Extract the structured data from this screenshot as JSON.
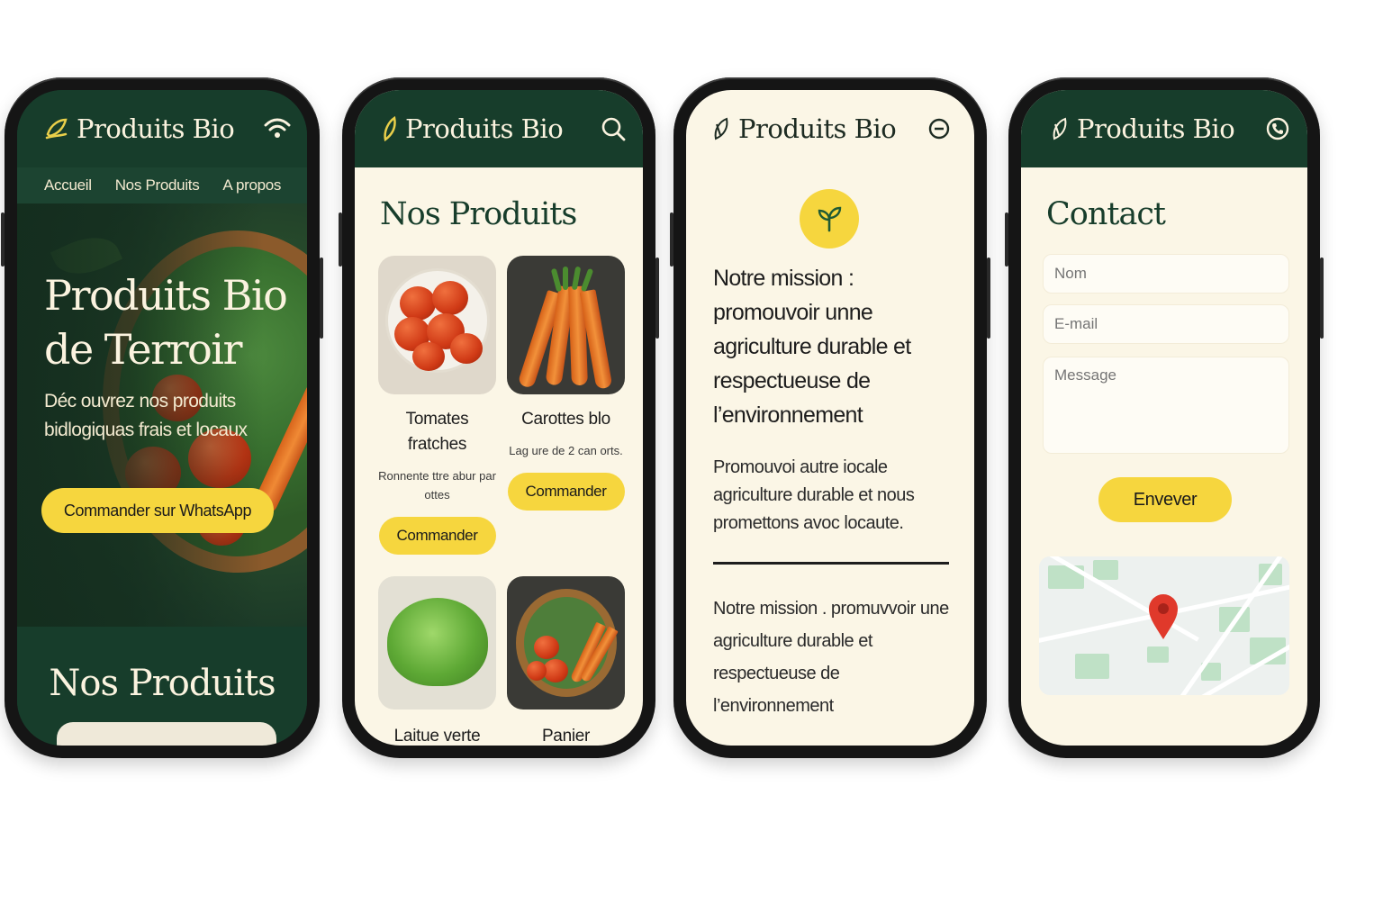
{
  "brand": "Produits Bio",
  "colors": {
    "dark_green": "#173d2b",
    "cream": "#fbf6e6",
    "accent_yellow": "#f6d63e",
    "map_pin": "#e0392b"
  },
  "home": {
    "header_icon": "wifi-icon",
    "nav": [
      "Accueil",
      "Nos Produits",
      "A propos"
    ],
    "hero_title_line1": "Produits Bio",
    "hero_title_line2": "de Terroir",
    "hero_subtitle": "Déc ouvrez nos produits bidlogiquas frais et locaux",
    "cta": "Commander sur WhatsApp",
    "section_title": "Nos Produits"
  },
  "products": {
    "header_icon": "search-icon",
    "title": "Nos Produits",
    "items": [
      {
        "name": "Tomates fratches",
        "desc": "Ronnente ttre abur par ottes",
        "button": "Commander"
      },
      {
        "name": "Carottes blo",
        "desc": "Lag ure de 2 can orts.",
        "button": "Commander"
      },
      {
        "name": "Laitue verte"
      },
      {
        "name": "Panier"
      }
    ]
  },
  "about": {
    "header_icon": "minus-circle-icon",
    "badge_icon": "sprout-icon",
    "mission_heading": "Notre mission : promouvoir unne agriculture durable et respectueuse de l’environnement",
    "mission_body": "Promouvoi autre iocale agriculture durable et nous promettons avoc locaute.",
    "mission_quote": "Notre mission . promuvvoir une agriculture durable et respectueuse de l’environnement"
  },
  "contact": {
    "header_icon": "phone-icon",
    "title": "Contact",
    "name_placeholder": "Nom",
    "email_placeholder": "E-mail",
    "message_placeholder": "Message",
    "send": "Envever",
    "map_icon": "map-pin-icon"
  }
}
